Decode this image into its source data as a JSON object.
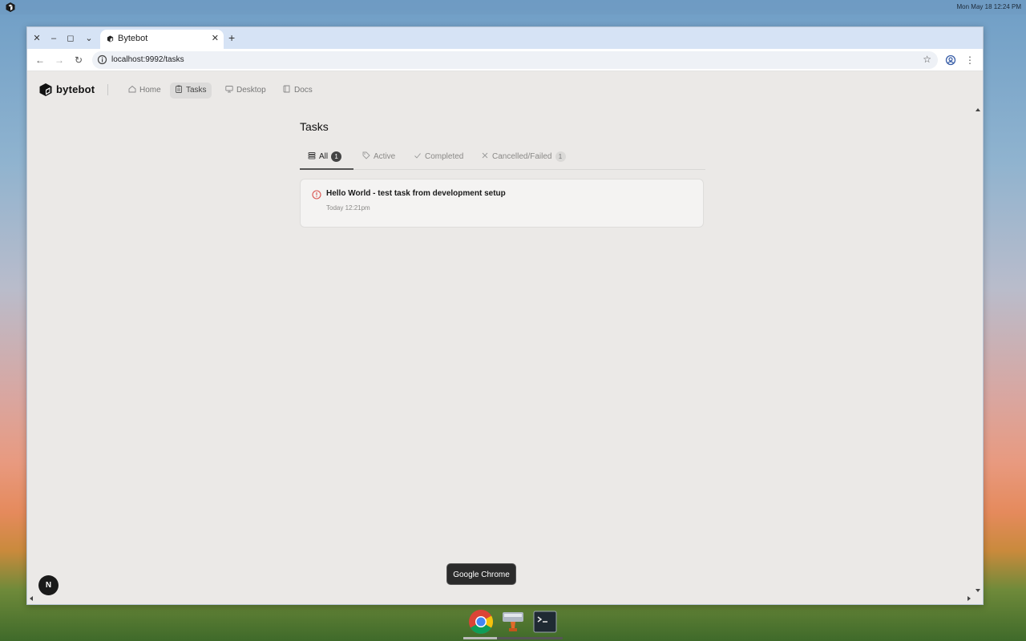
{
  "desktop": {
    "clock": "Mon May 18  12:24 PM"
  },
  "browser": {
    "tab_title": "Bytebot",
    "url": "localhost:9992/tasks",
    "window_controls": [
      "close",
      "minimize",
      "maximize",
      "tab-search"
    ]
  },
  "app": {
    "brand": "bytebot",
    "nav": [
      {
        "label": "Home",
        "icon": "home-icon"
      },
      {
        "label": "Tasks",
        "icon": "clipboard-icon",
        "active": true
      },
      {
        "label": "Desktop",
        "icon": "monitor-icon"
      },
      {
        "label": "Docs",
        "icon": "book-icon"
      }
    ]
  },
  "tasks_page": {
    "title": "Tasks",
    "filter_tabs": [
      {
        "label": "All",
        "count": "1",
        "active": true,
        "icon": "stack-icon"
      },
      {
        "label": "Active",
        "icon": "tag-icon"
      },
      {
        "label": "Completed",
        "icon": "check-icon"
      },
      {
        "label": "Cancelled/Failed",
        "count": "1",
        "icon": "x-icon"
      }
    ],
    "tasks": [
      {
        "title": "Hello World - test task from development setup",
        "date": "Today 12:21pm",
        "status": "failed",
        "status_color": "#d9534f"
      }
    ]
  },
  "dev_badge": "N",
  "tooltip": "Google Chrome",
  "dock": {
    "apps": [
      "chrome-icon",
      "file-manager-icon",
      "terminal-icon"
    ]
  }
}
